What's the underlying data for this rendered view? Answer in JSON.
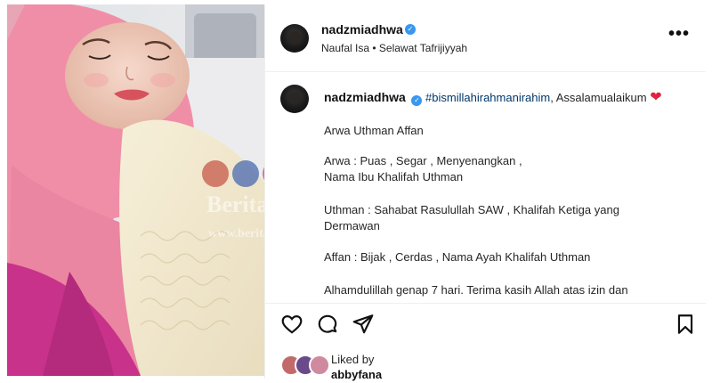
{
  "post": {
    "header": {
      "username": "nadzmiadhwa",
      "audio": "Naufal Isa • Selawat Tafrijiyyah",
      "more_label": "•••"
    },
    "caption": {
      "username": "nadzmiadhwa",
      "hashtag": "#bismillahirahmanirahim",
      "greeting": ", Assalamualaikum",
      "lines": [
        "Arwa Uthman Affan",
        "Arwa : Puas , Segar , Menyenangkan ,",
        "Nama Ibu Khalifah Uthman",
        "Uthman : Sahabat Rasulullah SAW , Khalifah Ketiga yang",
        "Dermawan",
        "Affan : Bijak , Cerdas , Nama Ayah Khalifah Uthman",
        "Alhamdulillah genap 7 hari. Terima kasih Allah atas izin dan"
      ]
    },
    "likes": {
      "liked_by_label": "Liked by",
      "liked_user": "abbyfana"
    },
    "watermark": {
      "brand": "Berita Kopak",
      "url": "www.beritakopak.com"
    }
  },
  "colors": {
    "verified": "#3897f0",
    "hashtag": "#00376b",
    "heart": "#e0243b",
    "hijab": "#f08ea8"
  },
  "icons": [
    "heart-outline",
    "comment-bubble",
    "paper-plane",
    "bookmark",
    "verified-badge",
    "red-heart-emoji",
    "facebook",
    "instagram",
    "globe"
  ]
}
